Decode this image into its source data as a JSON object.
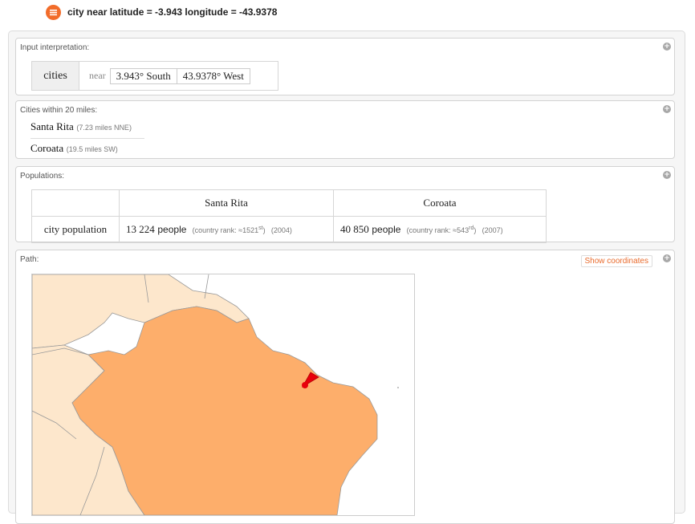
{
  "query": {
    "text": "city near latitude = -3.943 longitude = -43.9378",
    "logo_icon": "wolfram-alpha-logo-icon",
    "logo_color": "#f26c2a"
  },
  "pods": {
    "input": {
      "title": "Input interpretation:",
      "cities_label": "cities",
      "near_label": "near",
      "lat": "3.943°  South",
      "lon": "43.9378°  West"
    },
    "cities": {
      "title": "Cities within 20 miles:",
      "items": [
        {
          "name": "Santa Rita",
          "detail": "(7.23 miles NNE)"
        },
        {
          "name": "Coroata",
          "detail": "(19.5 miles SW)"
        }
      ]
    },
    "populations": {
      "title": "Populations:",
      "columns": [
        "Santa Rita",
        "Coroata"
      ],
      "row_label": "city population",
      "cells": [
        {
          "value": "13 224",
          "unit": "people",
          "rank_prefix": "(country rank:  ≈1521",
          "rank_sup": "st",
          "rank_suffix": ")",
          "year": "(2004)"
        },
        {
          "value": "40 850",
          "unit": "people",
          "rank_prefix": "(country rank:  ≈543",
          "rank_sup": "rd",
          "rank_suffix": ")",
          "year": "(2007)"
        }
      ]
    },
    "path": {
      "title": "Path:",
      "show_coords_label": "Show coordinates",
      "colors": {
        "brazil": "#fdae6b",
        "neighbors": "#fde7cc",
        "marker": "#e8000b"
      }
    },
    "plus_icon": "+"
  }
}
